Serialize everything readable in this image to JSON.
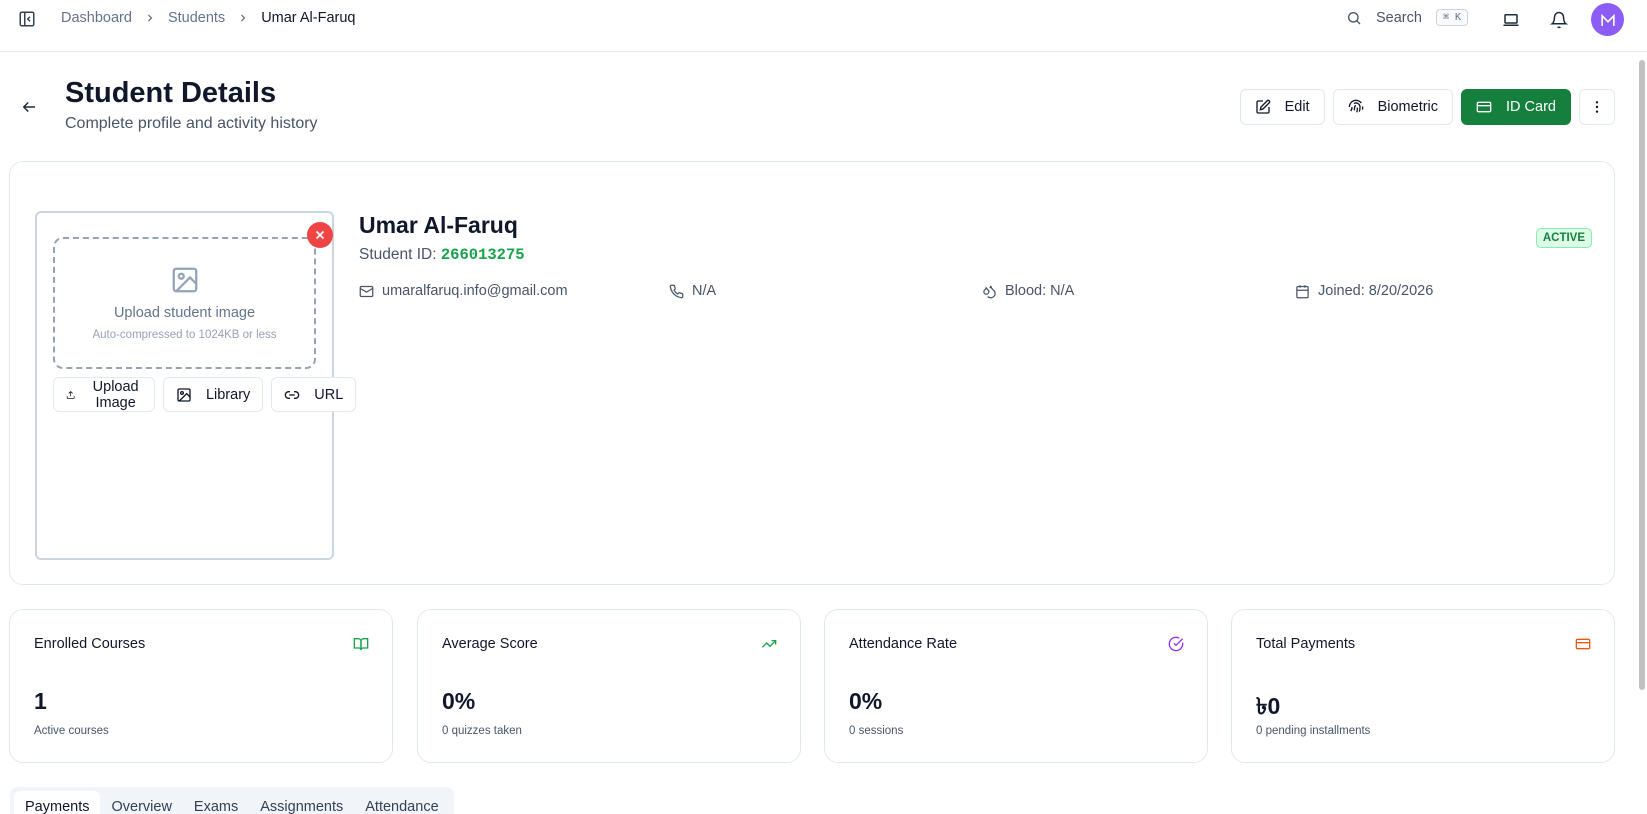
{
  "breadcrumb": [
    "Dashboard",
    "Students",
    "Umar Al-Faruq"
  ],
  "search": {
    "label": "Search",
    "shortcut": "⌘ K"
  },
  "header": {
    "title": "Student Details",
    "subtitle": "Complete profile and activity history"
  },
  "actions": {
    "edit": "Edit",
    "biometric": "Biometric",
    "id_card": "ID Card"
  },
  "upload": {
    "title": "Upload student image",
    "hint": "Auto-compressed to 1024KB or less",
    "upload_button": "Upload Image",
    "library_button": "Library",
    "url_button": "URL"
  },
  "student": {
    "name": "Umar Al-Faruq",
    "id_label": "Student ID:",
    "id": "266013275",
    "status": "ACTIVE",
    "email": "umaralfaruq.info@gmail.com",
    "phone": "N/A",
    "blood": "Blood: N/A",
    "joined": "Joined: 8/20/2026"
  },
  "stats": [
    {
      "label": "Enrolled Courses",
      "value": "1",
      "sub": "Active courses",
      "icon": "book-open-icon",
      "color": "#16a34a"
    },
    {
      "label": "Average Score",
      "value": "0%",
      "sub": "0 quizzes taken",
      "icon": "trending-up-icon",
      "color": "#16a34a"
    },
    {
      "label": "Attendance Rate",
      "value": "0%",
      "sub": "0 sessions",
      "icon": "check-circle-icon",
      "color": "#9333ea"
    },
    {
      "label": "Total Payments",
      "value": "৳0",
      "sub": "0 pending installments",
      "icon": "credit-card-icon",
      "color": "#ea580c"
    }
  ],
  "tabs": [
    "Payments",
    "Overview",
    "Exams",
    "Assignments",
    "Attendance"
  ],
  "colors": {
    "primary": "#15803d",
    "accent_id": "#16a34a",
    "danger": "#ef4444",
    "avatar": "#8b5cf6"
  }
}
